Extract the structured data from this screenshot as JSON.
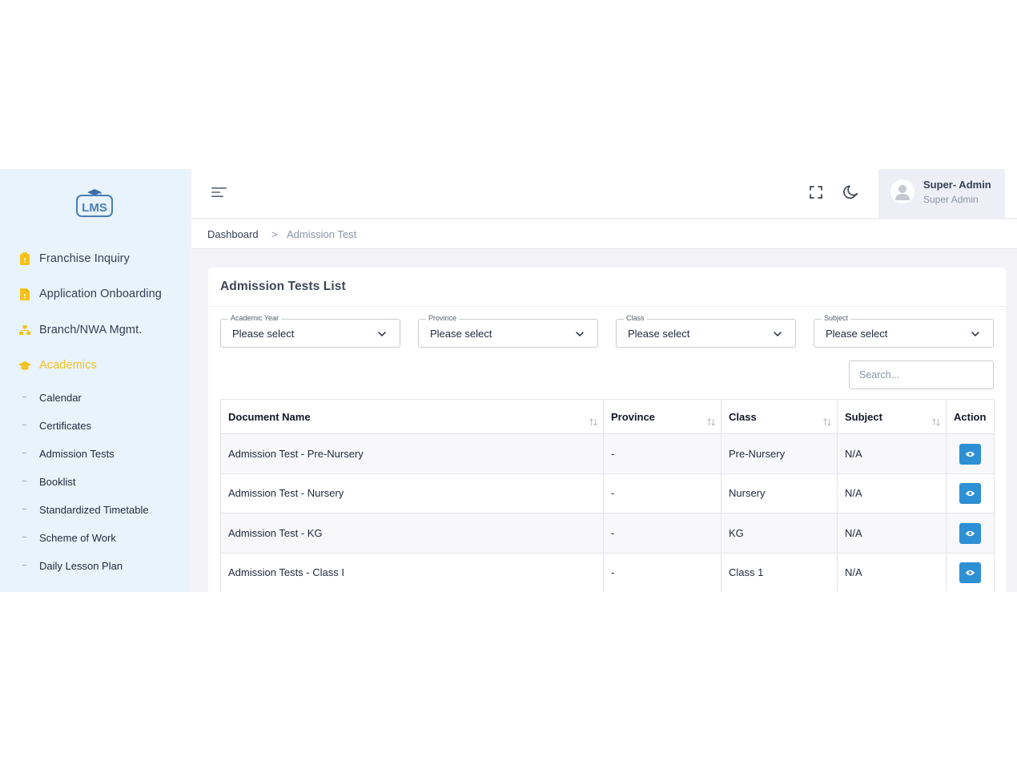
{
  "app": {
    "logo_text": "LMS"
  },
  "sidebar": {
    "items": [
      {
        "label": "Franchise Inquiry",
        "icon": "clipboard-icon",
        "active": false
      },
      {
        "label": "Application Onboarding",
        "icon": "document-icon",
        "active": false
      },
      {
        "label": "Branch/NWA Mgmt.",
        "icon": "sitemap-icon",
        "active": false
      },
      {
        "label": "Academics",
        "icon": "graduation-cap-icon",
        "active": true
      }
    ],
    "subitems": [
      {
        "label": "Calendar"
      },
      {
        "label": "Certificates"
      },
      {
        "label": "Admission Tests"
      },
      {
        "label": "Booklist"
      },
      {
        "label": "Standardized Timetable"
      },
      {
        "label": "Scheme of Work"
      },
      {
        "label": "Daily Lesson Plan"
      }
    ],
    "accent": "#f4c21b"
  },
  "header": {
    "icons": [
      "menu-icon",
      "fullscreen-icon",
      "moon-icon"
    ],
    "user": {
      "name": "Super- Admin",
      "role": "Super Admin"
    }
  },
  "breadcrumb": {
    "home": "Dashboard",
    "separator": ">",
    "current": "Admission Test"
  },
  "main": {
    "title": "Admission Tests List",
    "filters": [
      {
        "label": "Academic Year",
        "value": "Please select"
      },
      {
        "label": "Province",
        "value": "Please select"
      },
      {
        "label": "Class",
        "value": "Please select"
      },
      {
        "label": "Subject",
        "value": "Please select"
      }
    ],
    "search": {
      "placeholder": "Search..."
    },
    "table": {
      "columns": [
        "Document Name",
        "Province",
        "Class",
        "Subject",
        "Action"
      ],
      "rows": [
        [
          "Admission Test - Pre-Nursery",
          "-",
          "Pre-Nursery",
          "N/A"
        ],
        [
          "Admission Test - Nursery",
          "-",
          "Nursery",
          "N/A"
        ],
        [
          "Admission Test - KG",
          "-",
          "KG",
          "N/A"
        ],
        [
          "Admission Tests - Class I",
          "-",
          "Class 1",
          "N/A"
        ]
      ],
      "action_icon": "eye-icon",
      "action_color": "#2d8fd4"
    }
  }
}
